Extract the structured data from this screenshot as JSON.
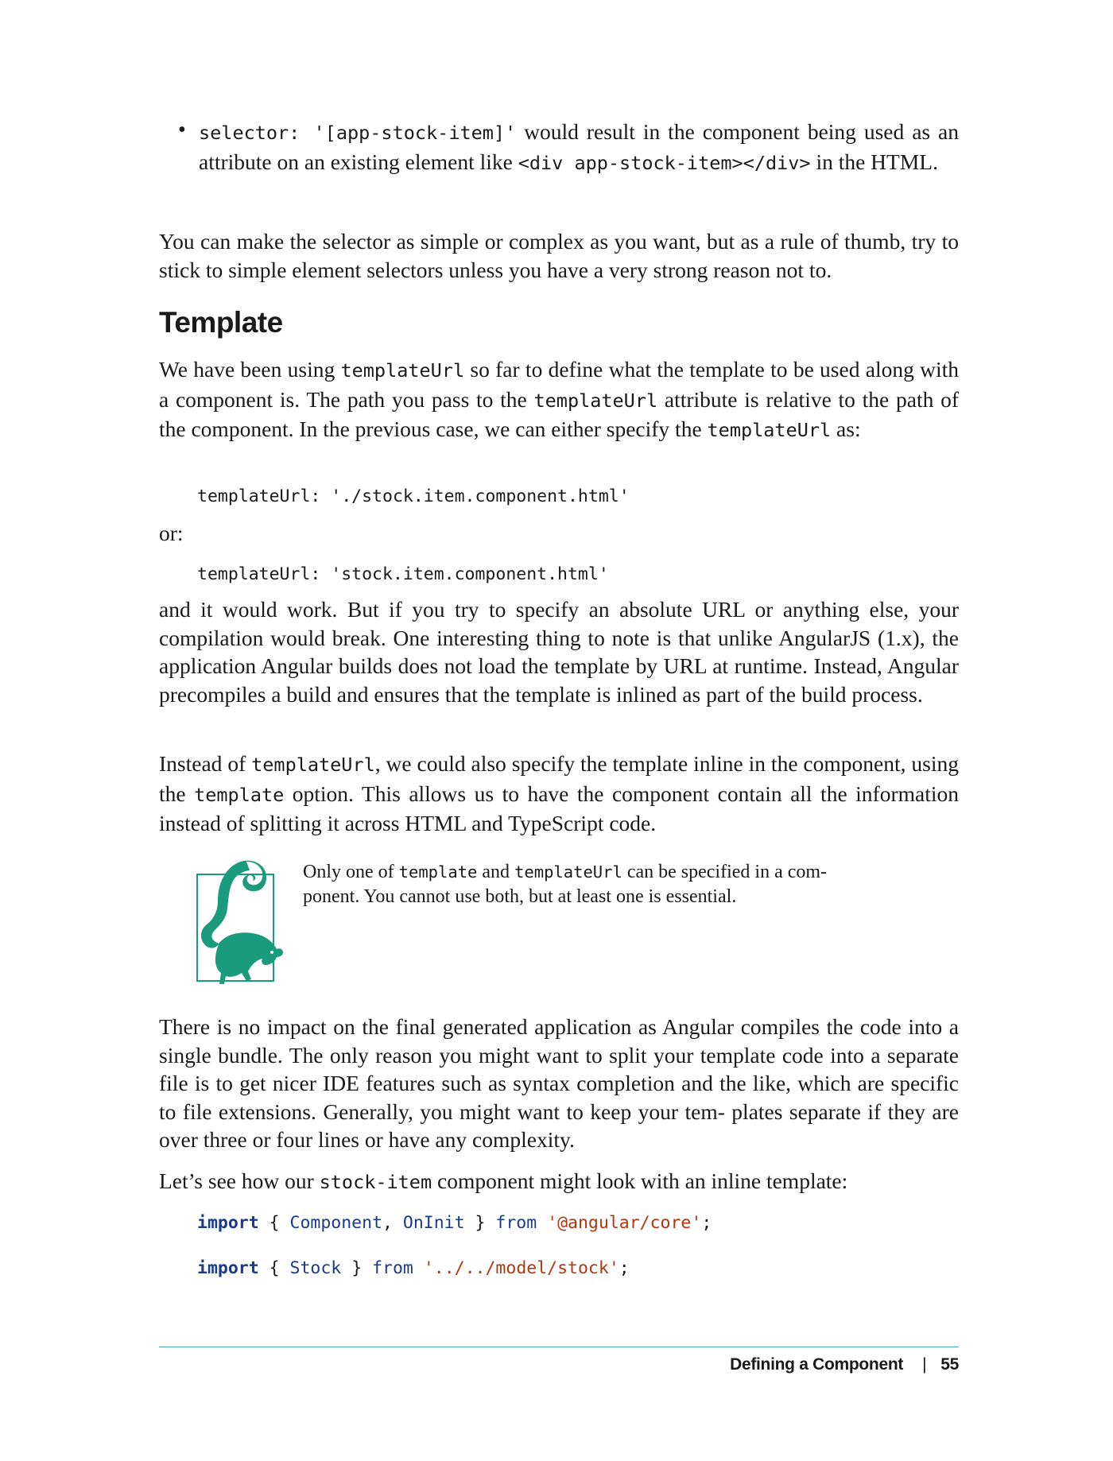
{
  "bullet": {
    "marker": "•",
    "code1": "selector: '[app-stock-item]'",
    "text1": " would result in the component being used as an attribute on an existing element like ",
    "code2": "<div app-stock-item></div>",
    "text2": " in the HTML."
  },
  "para_selector": "You can make the selector as simple or complex as you want, but as a rule of thumb, try to stick to simple element selectors unless you have a very strong reason not to.",
  "heading": "Template",
  "para_template": {
    "t1": "We have been using ",
    "c1": "templateUrl",
    "t2": " so far to define what the template to be used along with a component is. The path you pass to the ",
    "c2": "templateUrl",
    "t3": " attribute is relative to the path of the component. In the previous case, we can either specify the ",
    "c3": "templateUrl",
    "t4": " as:"
  },
  "code_example_1": "templateUrl: './stock.item.component.html'",
  "or_label": "or:",
  "code_example_2": "templateUrl: 'stock.item.component.html'",
  "para_work": "and it would work. But if you try to specify an absolute URL or anything else, your compilation would break. One interesting thing to note is that unlike AngularJS (1.x), the application Angular builds does not load the template by URL at runtime. Instead, Angular precompiles a build and ensures that the template is inlined as part of the build process.",
  "para_inline": {
    "t1": "Instead of ",
    "c1": "templateUrl",
    "t2": ", we could also specify the template inline in the component, using the ",
    "c2": "template",
    "t3": " option. This allows us to have the component contain all the information instead of splitting it across HTML and TypeScript code."
  },
  "note": {
    "t1": "Only one of ",
    "c1": "template",
    "t2": " and ",
    "c2": "templateUrl",
    "t3": " can be specified in a com‐ ponent. You cannot use both, but at least one is essential.",
    "icon_color": "#1a9c7c"
  },
  "para_impact": "There is no impact on the final generated application as Angular compiles the code into a single bundle. The only reason you might want to split your template code into a separate file is to get nicer IDE features such as syntax completion and the like, which are specific to file extensions. Generally, you might want to keep your tem‐ plates separate if they are over three or four lines or have any complexity.",
  "para_lets": {
    "t1": "Let’s see how our ",
    "c1": "stock-item",
    "t2": " component might look with an inline template:"
  },
  "code_import_1": {
    "kw": "import",
    "open": " { ",
    "id1": "Component",
    "comma": ", ",
    "id2": "OnInit",
    "close": " } ",
    "from": "from",
    "sp": " ",
    "str": "'@angular/core'",
    "semi": ";"
  },
  "code_import_2": {
    "kw": "import",
    "open": " { ",
    "id1": "Stock",
    "close": " } ",
    "from": "from",
    "sp": " ",
    "str": "'../../model/stock'",
    "semi": ";"
  },
  "footer": {
    "section": "Defining a Component",
    "separator": "|",
    "page_number": "55",
    "rule_color": "#4aa9c9"
  }
}
